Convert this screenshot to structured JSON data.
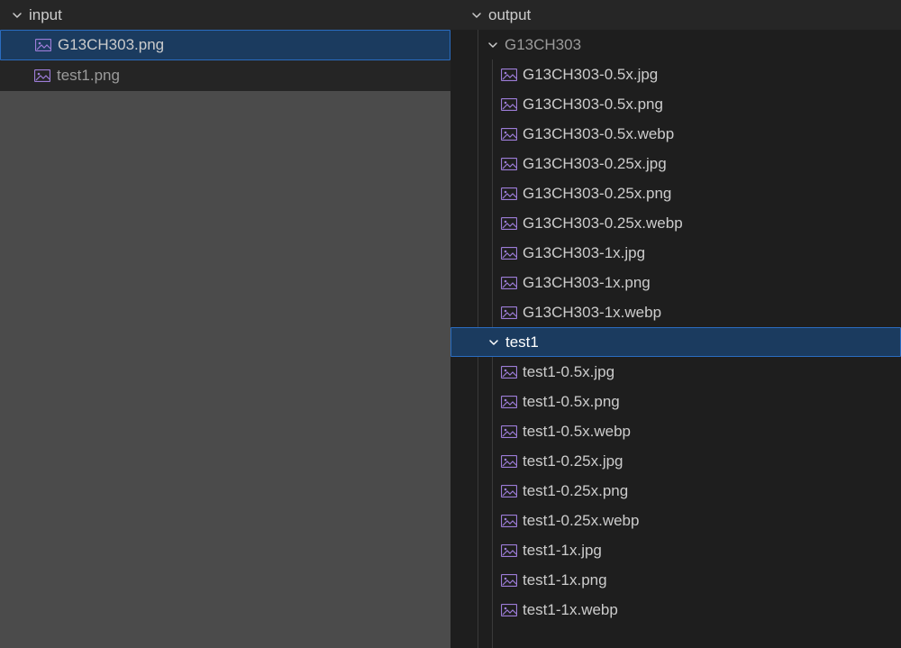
{
  "left": {
    "root": "input",
    "files": [
      {
        "name": "G13CH303.png",
        "selected": true
      },
      {
        "name": "test1.png",
        "selected": false
      }
    ]
  },
  "right": {
    "root": "output",
    "folders": [
      {
        "name": "G13CH303",
        "selected": false,
        "files": [
          "G13CH303-0.5x.jpg",
          "G13CH303-0.5x.png",
          "G13CH303-0.5x.webp",
          "G13CH303-0.25x.jpg",
          "G13CH303-0.25x.png",
          "G13CH303-0.25x.webp",
          "G13CH303-1x.jpg",
          "G13CH303-1x.png",
          "G13CH303-1x.webp"
        ]
      },
      {
        "name": "test1",
        "selected": true,
        "files": [
          "test1-0.5x.jpg",
          "test1-0.5x.png",
          "test1-0.5x.webp",
          "test1-0.25x.jpg",
          "test1-0.25x.png",
          "test1-0.25x.webp",
          "test1-1x.jpg",
          "test1-1x.png",
          "test1-1x.webp"
        ]
      }
    ]
  },
  "colors": {
    "icon": "#9d7dd8",
    "selection_bg": "#1b3b5f",
    "selection_border": "#2a6cc0"
  }
}
